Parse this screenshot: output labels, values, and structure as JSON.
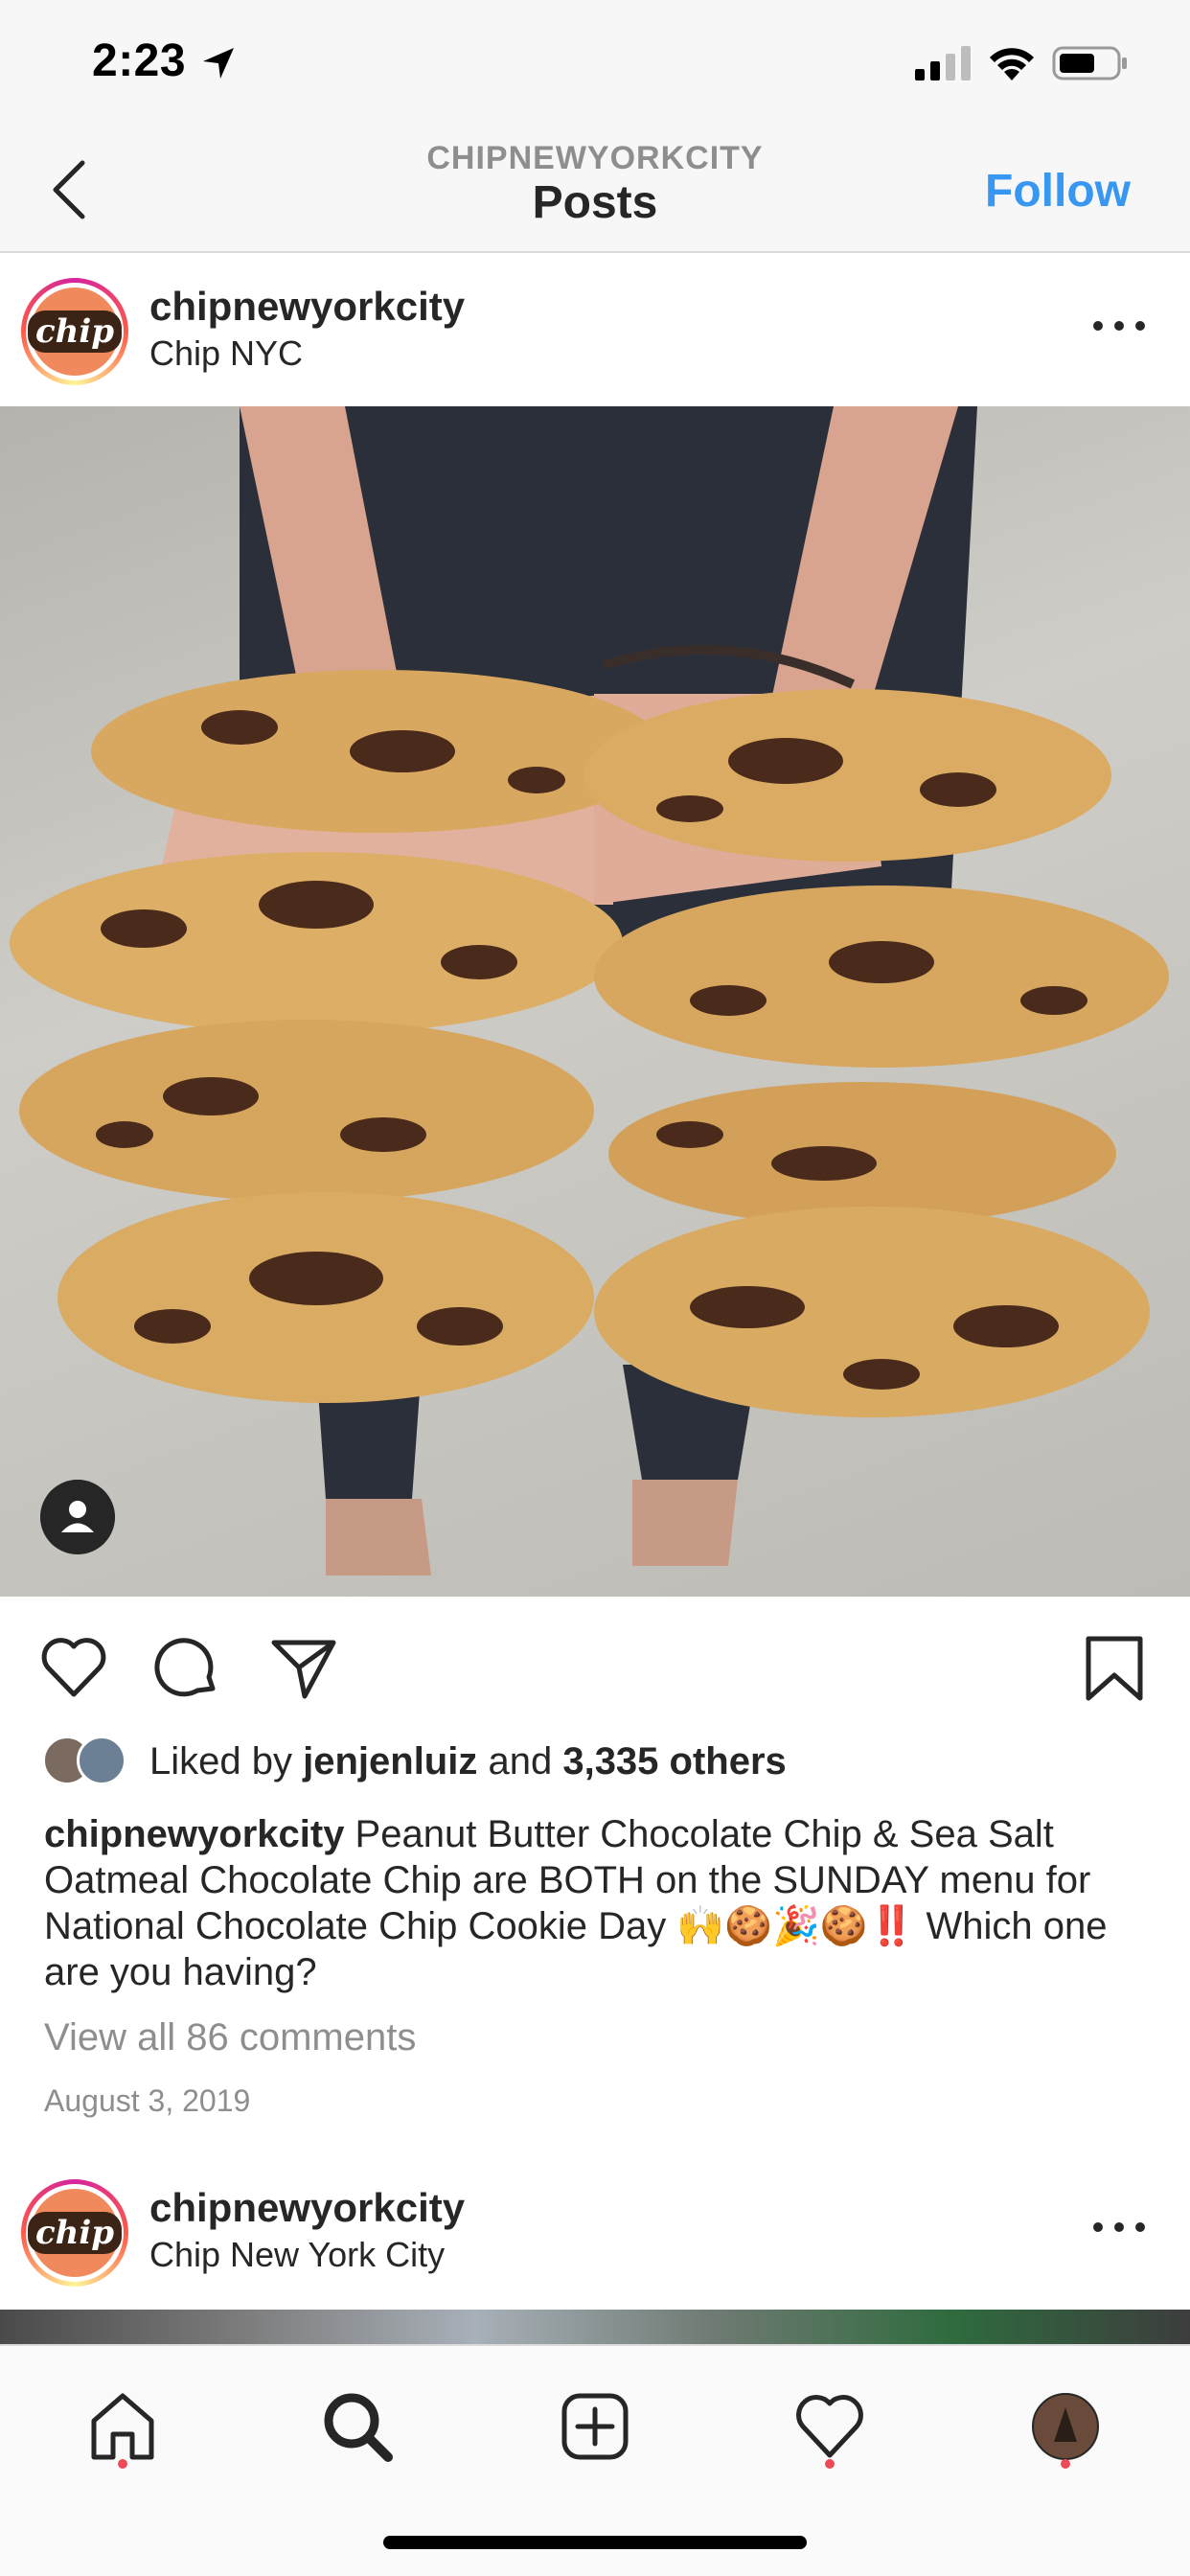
{
  "status_bar": {
    "time": "2:23"
  },
  "nav": {
    "subtitle": "CHIPNEWYORKCITY",
    "title": "Posts",
    "follow_label": "Follow"
  },
  "post": {
    "username": "chipnewyorkcity",
    "location": "Chip NYC",
    "avatar_text": "chip",
    "likes_prefix": "Liked by ",
    "likes_user": "jenjenluiz",
    "likes_middle": " and ",
    "likes_count": "3,335 others",
    "caption_user": "chipnewyorkcity",
    "caption_text": " Peanut Butter Chocolate Chip & Sea Salt Oatmeal Chocolate Chip are BOTH on the SUNDAY menu for National Chocolate Chip Cookie Day 🙌🍪🎉🍪‼️ Which one are you having?",
    "view_comments": "View all 86 comments",
    "date": "August 3, 2019"
  },
  "next_post": {
    "username": "chipnewyorkcity",
    "location": "Chip New York City",
    "avatar_text": "chip"
  },
  "colors": {
    "link_blue": "#3897f0",
    "notification_dot": "#ed4956",
    "brand_orange": "#f08a5d"
  },
  "icons": {
    "status": [
      "location-arrow-icon",
      "cellular-signal-icon",
      "wifi-icon",
      "battery-icon"
    ],
    "actions": [
      "heart-icon",
      "comment-icon",
      "share-icon",
      "bookmark-icon"
    ],
    "tabs": [
      "home-icon",
      "search-icon",
      "add-post-icon",
      "activity-heart-icon",
      "profile-avatar-icon"
    ]
  }
}
